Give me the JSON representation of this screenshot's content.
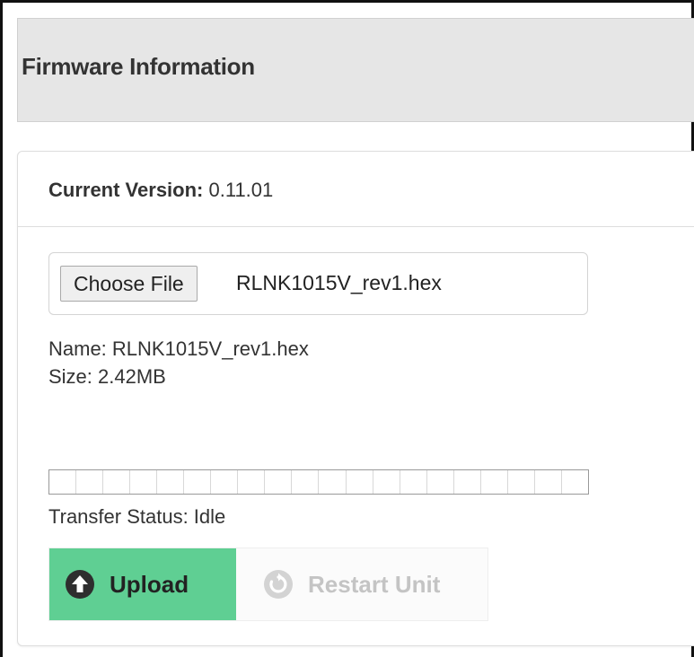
{
  "header": {
    "title": "Firmware Information"
  },
  "version": {
    "label": "Current Version:",
    "value": "0.11.01"
  },
  "file_input": {
    "button_label": "Choose File",
    "selected_file": "RLNK1015V_rev1.hex"
  },
  "file_info": {
    "name_line": "Name: RLNK1015V_rev1.hex",
    "size_line": "Size: 2.42MB"
  },
  "progress": {
    "value_percent": 0,
    "segments": 20
  },
  "transfer": {
    "status_line": "Transfer Status: Idle"
  },
  "actions": {
    "upload_label": "Upload",
    "upload_icon": "arrow-up-circle-icon",
    "restart_label": "Restart Unit",
    "restart_icon": "refresh-circle-icon",
    "restart_enabled": false
  },
  "colors": {
    "upload_bg": "#5fcf93",
    "header_bg": "#e6e6e6",
    "disabled_text": "#c4c4c4"
  }
}
